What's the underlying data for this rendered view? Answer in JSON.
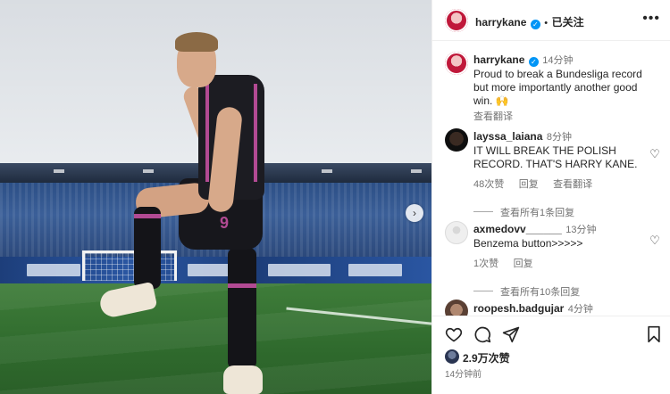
{
  "photo": {
    "jersey_number": "9",
    "next_icon": "chevron-right-icon"
  },
  "header": {
    "username": "harrykane",
    "verified_icon": "verified-badge-icon",
    "separator": "•",
    "follow_status": "已关注",
    "more_icon": "more-horizontal-icon"
  },
  "caption": {
    "username": "harrykane",
    "time": "14分钟",
    "text": "Proud to break a Bundesliga record but more importantly another good win. 🙌",
    "translate": "查看翻译"
  },
  "comments": [
    {
      "username": "layssa_laiana",
      "time": "8分钟",
      "text": "IT WILL BREAK THE POLISH RECORD. THAT'S HARRY KANE.",
      "likes": "48次赞",
      "reply": "回复",
      "translate": "查看翻译",
      "view_replies": "查看所有1条回复"
    },
    {
      "username": "axmedovv______",
      "time": "13分钟",
      "text": "Benzema button>>>>>",
      "likes": "1次赞",
      "reply": "回复",
      "view_replies": "查看所有10条回复"
    },
    {
      "username": "roopesh.badgujar",
      "time": "4分钟"
    }
  ],
  "footer": {
    "likes": "2.9万次赞",
    "time": "14分钟前"
  },
  "colors": {
    "accent": "#0095f6",
    "jersey_accent": "#b24a93"
  }
}
